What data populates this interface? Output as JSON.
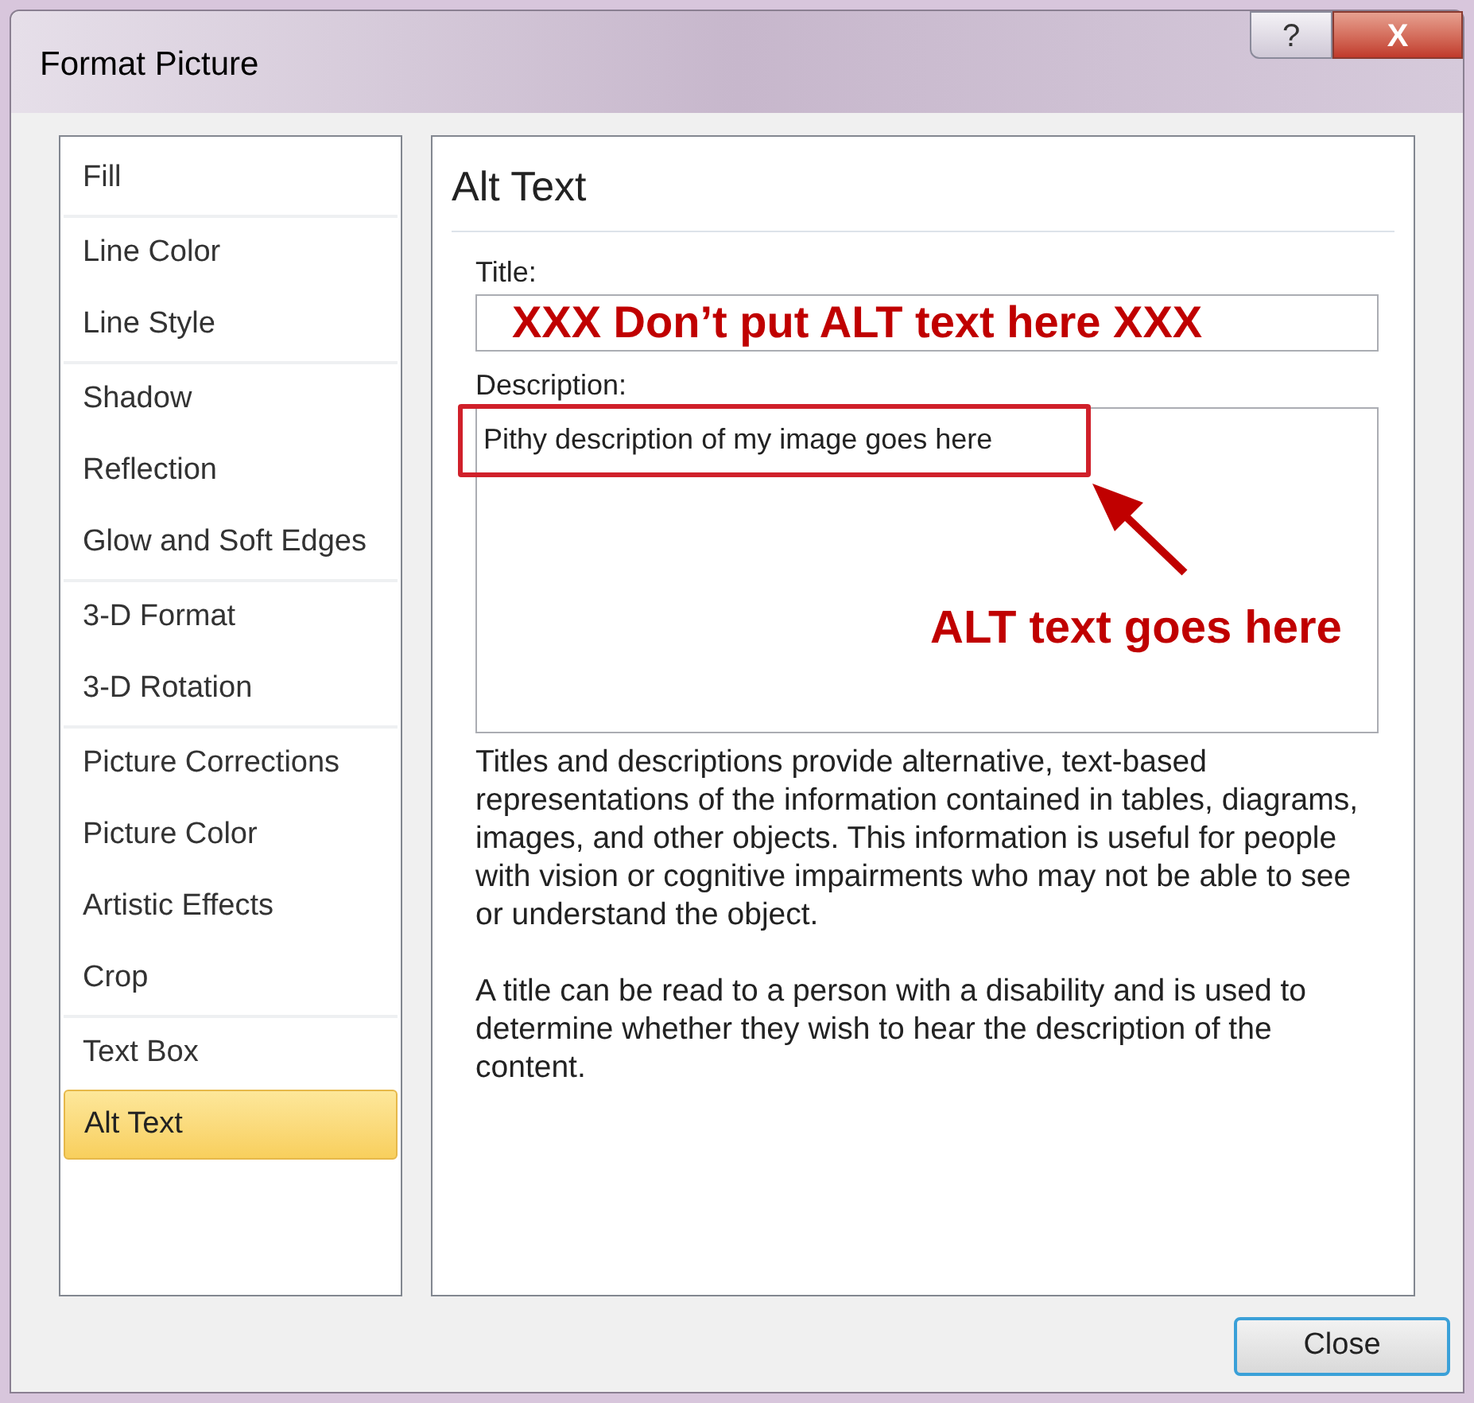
{
  "window": {
    "title": "Format Picture",
    "buttons": [
      "?",
      "X"
    ]
  },
  "sidebar": {
    "groups": [
      {
        "items": [
          {
            "label": "Fill",
            "selected": false
          }
        ]
      },
      {
        "items": [
          {
            "label": "Line Color",
            "selected": false
          },
          {
            "label": "Line Style",
            "selected": false
          }
        ]
      },
      {
        "items": [
          {
            "label": "Shadow",
            "selected": false
          },
          {
            "label": "Reflection",
            "selected": false
          },
          {
            "label": "Glow and Soft Edges",
            "selected": false
          }
        ]
      },
      {
        "items": [
          {
            "label": "3-D Format",
            "selected": false
          },
          {
            "label": "3-D Rotation",
            "selected": false
          }
        ]
      },
      {
        "items": [
          {
            "label": "Picture Corrections",
            "selected": false
          },
          {
            "label": "Picture Color",
            "selected": false
          },
          {
            "label": "Artistic Effects",
            "selected": false
          },
          {
            "label": "Crop",
            "selected": false
          }
        ]
      },
      {
        "items": [
          {
            "label": "Text Box",
            "selected": false
          },
          {
            "label": "Alt Text",
            "selected": true
          }
        ]
      }
    ]
  },
  "panel": {
    "heading": "Alt Text",
    "title_label": "Title:",
    "title_value": "XXX Don’t put ALT text here XXX",
    "description_label": "Description:",
    "description_value": "Pithy description of my image goes here",
    "callout": "ALT text goes here",
    "paragraphs": [
      "Titles and descriptions provide alternative, text-based representations of the information contained in tables, diagrams, images, and other objects. This information is useful for people with vision or cognitive impairments who may not be able to see or understand the object.",
      "A title can be read to a person with a disability and is used to determine whether they wish to hear the description of the content."
    ]
  },
  "footer": {
    "button": "Close"
  }
}
